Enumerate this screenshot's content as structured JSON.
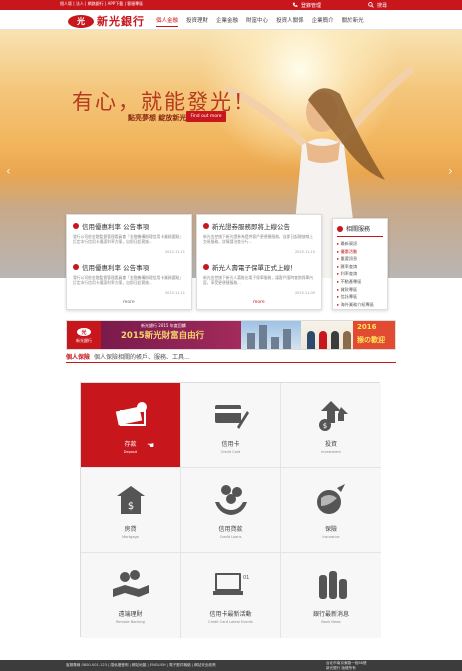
{
  "topbar": {
    "links": "個人版 | 法人 | 網路銀行 | APP下載 | 客服專區",
    "login": "登錄管理",
    "search": "搜尋"
  },
  "header": {
    "logo_seal": "光",
    "logo_text": "新光銀行",
    "nav": [
      "個人金融",
      "投資理財",
      "企業金融",
      "財富中心",
      "投資人關係",
      "企業簡介",
      "關於新光"
    ]
  },
  "hero": {
    "title": "有心，就能發光！",
    "subtitle": "點亮夢想 綻放新光",
    "button": "Find out more"
  },
  "news": [
    {
      "title": "信用優惠利率 公告事項",
      "body": "發行公司依金融監督管理委員會「金融機構辦理信用卡業務要點」訂定本行信用卡優惠利率方案，自即日起實施...",
      "date": "2015.11.11"
    },
    {
      "title": "信用優惠利率 公告事項",
      "body": "發行公司依金融監督管理委員會「金融機構辦理信用卡業務要點」訂定本行信用卡優惠利率方案，自即日起實施...",
      "date": "2015.11.11"
    },
    {
      "title": "新光證券服務即將上線公告",
      "body": "新光金控旗下新光證券為提供客戶更便捷服務，自即日起開放線上交易服務，詳情請洽各分行...",
      "date": "2015.11.10"
    },
    {
      "title": "新光人壽電子保單正式上線！",
      "body": "新光金控旗下新光人壽推出電子保單服務，讓客戶隨時查詢保單內容，享受更便捷服務...",
      "date": "2015.11.09"
    }
  ],
  "more_label": "more",
  "side": {
    "title": "相關服務",
    "items": [
      "最新資訊",
      "優惠活動",
      "重要訊息",
      "匯率查詢",
      "利率查詢",
      "不動產專區",
      "貸款專區",
      "信託專區",
      "海外業務介紹專區"
    ],
    "highlight_index": 1
  },
  "banner": {
    "logo": "新光銀行",
    "small": "新光銀行 2015 年度回饋",
    "big": "2015新光財富自由行",
    "year": "2016",
    "right_text": "猴の歡迎"
  },
  "section": {
    "title": "個人保險",
    "desc": "個人保險相關的帳戶、服務、工具..."
  },
  "services": [
    {
      "zh": "存款",
      "en": "Deposit",
      "icon": "deposit-icon"
    },
    {
      "zh": "信用卡",
      "en": "Credit Card",
      "icon": "credit-card-icon"
    },
    {
      "zh": "投資",
      "en": "Investment",
      "icon": "investment-icon"
    },
    {
      "zh": "房貸",
      "en": "Mortgage",
      "icon": "mortgage-icon"
    },
    {
      "zh": "信用貸款",
      "en": "Credit Loans",
      "icon": "credit-loans-icon"
    },
    {
      "zh": "保險",
      "en": "Insurance",
      "icon": "insurance-icon"
    },
    {
      "zh": "遠端理財",
      "en": "Remote Banking",
      "icon": "remote-banking-icon"
    },
    {
      "zh": "信用卡最新活動",
      "en": "Credit Card Latest Events",
      "icon": "card-events-icon"
    },
    {
      "zh": "銀行最新消息",
      "en": "Bank News",
      "icon": "bank-news-icon"
    }
  ],
  "footer": {
    "left": "客服專線 0800-001-123 | 隱私權聲明 | 網站地圖 | ENGLISH | 電子郵件聯絡 | 網站安全政策",
    "right_line1": "台北市南京東路一段86號",
    "right_line2": "新光銀行 版權所有"
  },
  "colors": {
    "accent": "#c8161d"
  }
}
